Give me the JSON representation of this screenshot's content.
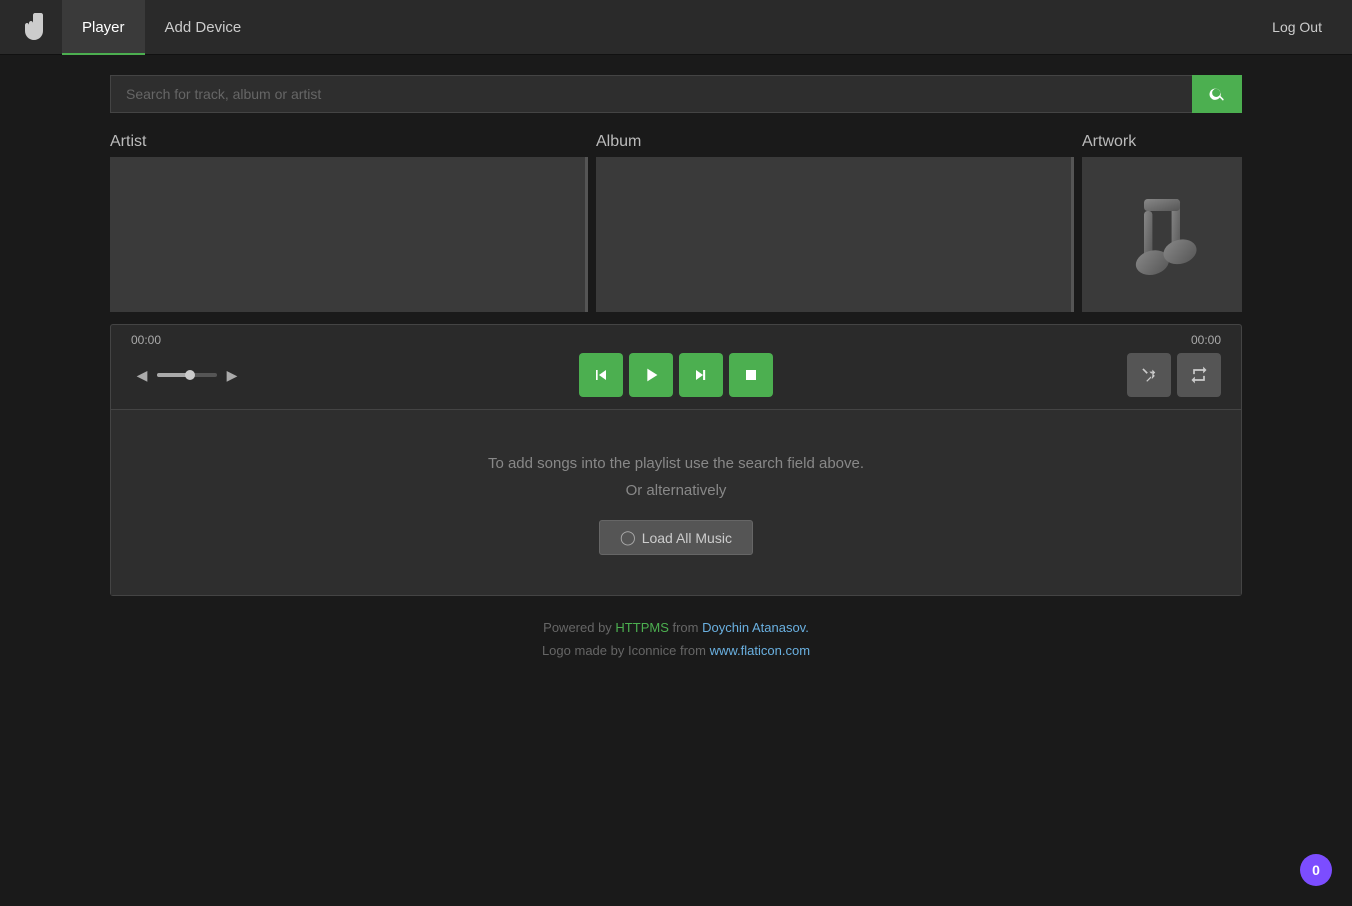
{
  "navbar": {
    "logo_label": "hand-icon",
    "tabs": [
      {
        "id": "player",
        "label": "Player",
        "active": true
      },
      {
        "id": "add-device",
        "label": "Add Device",
        "active": false
      }
    ],
    "logout_label": "Log Out"
  },
  "search": {
    "placeholder": "Search for track, album or artist",
    "button_label": "search"
  },
  "panels": {
    "artist_label": "Artist",
    "album_label": "Album",
    "artwork_label": "Artwork"
  },
  "player": {
    "time_start": "00:00",
    "time_end": "00:00",
    "controls": {
      "prev_label": "⏮",
      "play_label": "▶",
      "next_label": "⏭",
      "stop_label": "■",
      "shuffle_label": "⇄",
      "repeat_label": "↻"
    }
  },
  "playlist": {
    "hint_line1": "To add songs into the playlist use the search field above.",
    "hint_line2": "Or alternatively",
    "load_button_label": "Load All Music"
  },
  "footer": {
    "powered_by": "Powered by ",
    "httpms_label": "HTTPMS",
    "from_label": " from ",
    "author_label": "Doychin Atanasov.",
    "logo_line": "Logo made by Iconnice from ",
    "flaticon_label": "www.flaticon.com"
  },
  "badge": {
    "value": "0"
  },
  "colors": {
    "green": "#4caf50",
    "grey_btn": "#555555",
    "badge_purple": "#7c4dff"
  }
}
